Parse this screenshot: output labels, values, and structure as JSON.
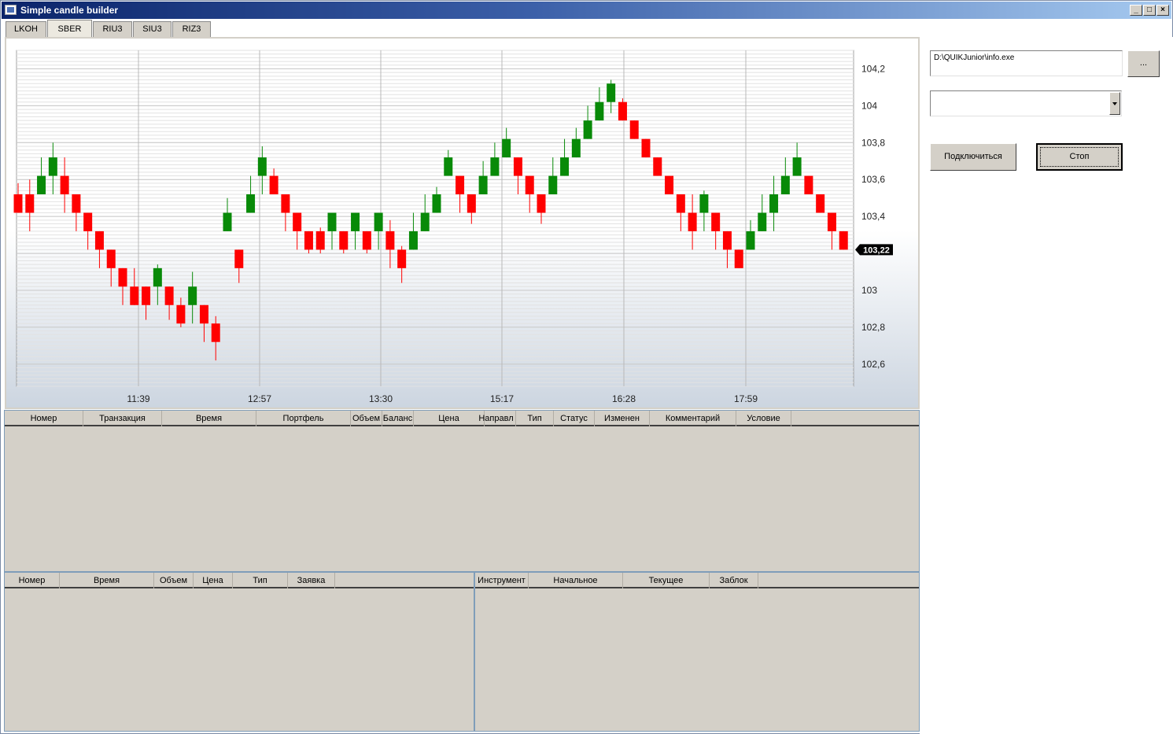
{
  "window": {
    "title": "Simple candle builder",
    "controls": {
      "minimize": "_",
      "maximize": "□",
      "close": "×"
    }
  },
  "tabs": [
    "LKOH",
    "SBER",
    "RIU3",
    "SIU3",
    "RIZ3"
  ],
  "active_tab": "SBER",
  "chart_data": {
    "type": "candlestick",
    "y_ticks": [
      "104,2",
      "104",
      "103,8",
      "103,6",
      "103,4",
      "103",
      "102,8",
      "102,6"
    ],
    "x_ticks": [
      "11:39",
      "12:57",
      "13:30",
      "15:17",
      "16:28",
      "17:59"
    ],
    "ylim": [
      102.48,
      104.3
    ],
    "current_price": "103,22",
    "colors": {
      "up": "#088a08",
      "down": "#ff0000",
      "wick": "#444444"
    },
    "candles": [
      {
        "o": 103.52,
        "c": 103.42,
        "h": 103.58,
        "l": 103.42
      },
      {
        "o": 103.52,
        "c": 103.42,
        "h": 103.6,
        "l": 103.32
      },
      {
        "o": 103.52,
        "c": 103.62,
        "h": 103.72,
        "l": 103.52
      },
      {
        "o": 103.62,
        "c": 103.72,
        "h": 103.8,
        "l": 103.52
      },
      {
        "o": 103.62,
        "c": 103.52,
        "h": 103.72,
        "l": 103.42
      },
      {
        "o": 103.52,
        "c": 103.42,
        "h": 103.52,
        "l": 103.32
      },
      {
        "o": 103.42,
        "c": 103.32,
        "h": 103.42,
        "l": 103.22
      },
      {
        "o": 103.32,
        "c": 103.22,
        "h": 103.32,
        "l": 103.12
      },
      {
        "o": 103.22,
        "c": 103.12,
        "h": 103.22,
        "l": 103.02
      },
      {
        "o": 103.12,
        "c": 103.02,
        "h": 103.12,
        "l": 102.92
      },
      {
        "o": 103.02,
        "c": 102.92,
        "h": 103.12,
        "l": 102.92
      },
      {
        "o": 103.02,
        "c": 102.92,
        "h": 103.02,
        "l": 102.84
      },
      {
        "o": 103.02,
        "c": 103.12,
        "h": 103.14,
        "l": 102.92
      },
      {
        "o": 103.02,
        "c": 102.92,
        "h": 103.02,
        "l": 102.84
      },
      {
        "o": 102.92,
        "c": 102.82,
        "h": 102.96,
        "l": 102.8
      },
      {
        "o": 102.92,
        "c": 103.02,
        "h": 103.1,
        "l": 102.82
      },
      {
        "o": 102.92,
        "c": 102.82,
        "h": 102.92,
        "l": 102.72
      },
      {
        "o": 102.82,
        "c": 102.72,
        "h": 102.86,
        "l": 102.62
      },
      {
        "o": 103.32,
        "c": 103.42,
        "h": 103.5,
        "l": 103.32
      },
      {
        "o": 103.22,
        "c": 103.12,
        "h": 103.22,
        "l": 103.04
      },
      {
        "o": 103.42,
        "c": 103.52,
        "h": 103.62,
        "l": 103.42
      },
      {
        "o": 103.62,
        "c": 103.72,
        "h": 103.78,
        "l": 103.52
      },
      {
        "o": 103.62,
        "c": 103.52,
        "h": 103.66,
        "l": 103.52
      },
      {
        "o": 103.52,
        "c": 103.42,
        "h": 103.52,
        "l": 103.32
      },
      {
        "o": 103.42,
        "c": 103.32,
        "h": 103.42,
        "l": 103.22
      },
      {
        "o": 103.32,
        "c": 103.22,
        "h": 103.32,
        "l": 103.2
      },
      {
        "o": 103.32,
        "c": 103.22,
        "h": 103.34,
        "l": 103.2
      },
      {
        "o": 103.32,
        "c": 103.42,
        "h": 103.42,
        "l": 103.22
      },
      {
        "o": 103.32,
        "c": 103.22,
        "h": 103.32,
        "l": 103.2
      },
      {
        "o": 103.32,
        "c": 103.42,
        "h": 103.42,
        "l": 103.22
      },
      {
        "o": 103.32,
        "c": 103.22,
        "h": 103.32,
        "l": 103.2
      },
      {
        "o": 103.32,
        "c": 103.42,
        "h": 103.42,
        "l": 103.22
      },
      {
        "o": 103.32,
        "c": 103.22,
        "h": 103.38,
        "l": 103.12
      },
      {
        "o": 103.22,
        "c": 103.12,
        "h": 103.24,
        "l": 103.04
      },
      {
        "o": 103.22,
        "c": 103.32,
        "h": 103.42,
        "l": 103.22
      },
      {
        "o": 103.32,
        "c": 103.42,
        "h": 103.52,
        "l": 103.32
      },
      {
        "o": 103.42,
        "c": 103.52,
        "h": 103.56,
        "l": 103.42
      },
      {
        "o": 103.62,
        "c": 103.72,
        "h": 103.76,
        "l": 103.62
      },
      {
        "o": 103.62,
        "c": 103.52,
        "h": 103.62,
        "l": 103.42
      },
      {
        "o": 103.52,
        "c": 103.42,
        "h": 103.52,
        "l": 103.36
      },
      {
        "o": 103.52,
        "c": 103.62,
        "h": 103.7,
        "l": 103.52
      },
      {
        "o": 103.62,
        "c": 103.72,
        "h": 103.8,
        "l": 103.62
      },
      {
        "o": 103.72,
        "c": 103.82,
        "h": 103.88,
        "l": 103.72
      },
      {
        "o": 103.72,
        "c": 103.62,
        "h": 103.72,
        "l": 103.52
      },
      {
        "o": 103.62,
        "c": 103.52,
        "h": 103.62,
        "l": 103.42
      },
      {
        "o": 103.52,
        "c": 103.42,
        "h": 103.52,
        "l": 103.36
      },
      {
        "o": 103.52,
        "c": 103.62,
        "h": 103.72,
        "l": 103.52
      },
      {
        "o": 103.62,
        "c": 103.72,
        "h": 103.82,
        "l": 103.62
      },
      {
        "o": 103.72,
        "c": 103.82,
        "h": 103.88,
        "l": 103.72
      },
      {
        "o": 103.82,
        "c": 103.92,
        "h": 104.0,
        "l": 103.82
      },
      {
        "o": 103.92,
        "c": 104.02,
        "h": 104.1,
        "l": 103.92
      },
      {
        "o": 104.02,
        "c": 104.12,
        "h": 104.14,
        "l": 103.96
      },
      {
        "o": 104.02,
        "c": 103.92,
        "h": 104.04,
        "l": 103.92
      },
      {
        "o": 103.92,
        "c": 103.82,
        "h": 103.92,
        "l": 103.82
      },
      {
        "o": 103.82,
        "c": 103.72,
        "h": 103.82,
        "l": 103.72
      },
      {
        "o": 103.72,
        "c": 103.62,
        "h": 103.72,
        "l": 103.62
      },
      {
        "o": 103.62,
        "c": 103.52,
        "h": 103.62,
        "l": 103.52
      },
      {
        "o": 103.52,
        "c": 103.42,
        "h": 103.52,
        "l": 103.32
      },
      {
        "o": 103.42,
        "c": 103.32,
        "h": 103.52,
        "l": 103.22
      },
      {
        "o": 103.42,
        "c": 103.52,
        "h": 103.54,
        "l": 103.32
      },
      {
        "o": 103.42,
        "c": 103.32,
        "h": 103.42,
        "l": 103.22
      },
      {
        "o": 103.32,
        "c": 103.22,
        "h": 103.32,
        "l": 103.12
      },
      {
        "o": 103.22,
        "c": 103.12,
        "h": 103.22,
        "l": 103.12
      },
      {
        "o": 103.22,
        "c": 103.32,
        "h": 103.38,
        "l": 103.22
      },
      {
        "o": 103.32,
        "c": 103.42,
        "h": 103.52,
        "l": 103.32
      },
      {
        "o": 103.42,
        "c": 103.52,
        "h": 103.62,
        "l": 103.32
      },
      {
        "o": 103.52,
        "c": 103.62,
        "h": 103.72,
        "l": 103.52
      },
      {
        "o": 103.62,
        "c": 103.72,
        "h": 103.8,
        "l": 103.62
      },
      {
        "o": 103.62,
        "c": 103.52,
        "h": 103.62,
        "l": 103.52
      },
      {
        "o": 103.52,
        "c": 103.42,
        "h": 103.52,
        "l": 103.42
      },
      {
        "o": 103.42,
        "c": 103.32,
        "h": 103.42,
        "l": 103.22
      },
      {
        "o": 103.32,
        "c": 103.22,
        "h": 103.32,
        "l": 103.22
      }
    ]
  },
  "right_panel": {
    "path_value": "D:\\QUIKJunior\\info.exe",
    "browse_label": "...",
    "combo_value": "",
    "connect_label": "Подключиться",
    "stop_label": "Стоп"
  },
  "orders_grid": {
    "columns": [
      "Номер",
      "Транзакция",
      "Время",
      "Портфель",
      "Объем",
      "Баланс",
      "Цена",
      "Направл",
      "Тип",
      "Статус",
      "Изменен",
      "Комментарий",
      "Условие"
    ]
  },
  "trades_grid": {
    "columns": [
      "Номер",
      "Время",
      "Объем",
      "Цена",
      "Тип",
      "Заявка"
    ]
  },
  "positions_grid": {
    "columns": [
      "Инструмент",
      "Начальное",
      "Текущее",
      "Заблок"
    ]
  }
}
